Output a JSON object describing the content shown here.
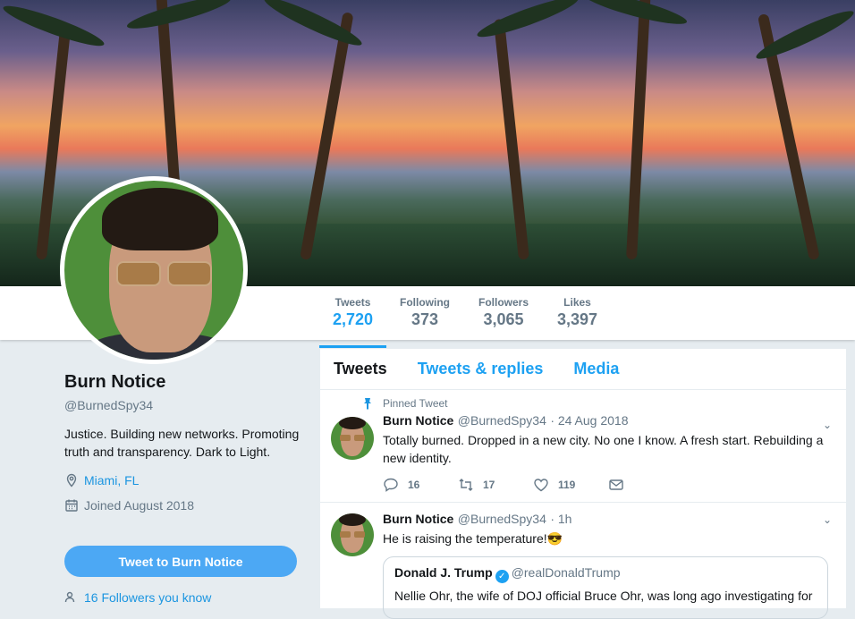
{
  "stats": [
    {
      "label": "Tweets",
      "value": "2,720",
      "active": true
    },
    {
      "label": "Following",
      "value": "373"
    },
    {
      "label": "Followers",
      "value": "3,065"
    },
    {
      "label": "Likes",
      "value": "3,397"
    }
  ],
  "profile": {
    "name": "Burn Notice",
    "handle": "@BurnedSpy34",
    "bio": "Justice. Building new networks. Promoting truth and transparency. Dark to Light.",
    "location": "Miami, FL",
    "joined": "Joined August 2018",
    "tweet_button": "Tweet to Burn Notice",
    "followers_you_know": "16 Followers you know"
  },
  "tabs": [
    "Tweets",
    "Tweets & replies",
    "Media"
  ],
  "tweets": [
    {
      "pinned_label": "Pinned Tweet",
      "name": "Burn Notice",
      "handle": "@BurnedSpy34",
      "time": "· 24 Aug 2018",
      "text": "Totally burned. Dropped in a new city. No one I know. A fresh start. Rebuilding a new identity.",
      "replies": "16",
      "retweets": "17",
      "likes": "119"
    },
    {
      "name": "Burn Notice",
      "handle": "@BurnedSpy34",
      "time": "· 1h",
      "text": "He is raising the temperature!😎",
      "quote": {
        "name": "Donald J. Trump",
        "handle": "@realDonaldTrump",
        "text": "Nellie Ohr, the wife of DOJ official Bruce Ohr, was long ago investigating for"
      }
    }
  ],
  "colors": {
    "accent": "#1da1f2",
    "button": "#4ca8f4",
    "background": "#e6ecf0"
  }
}
